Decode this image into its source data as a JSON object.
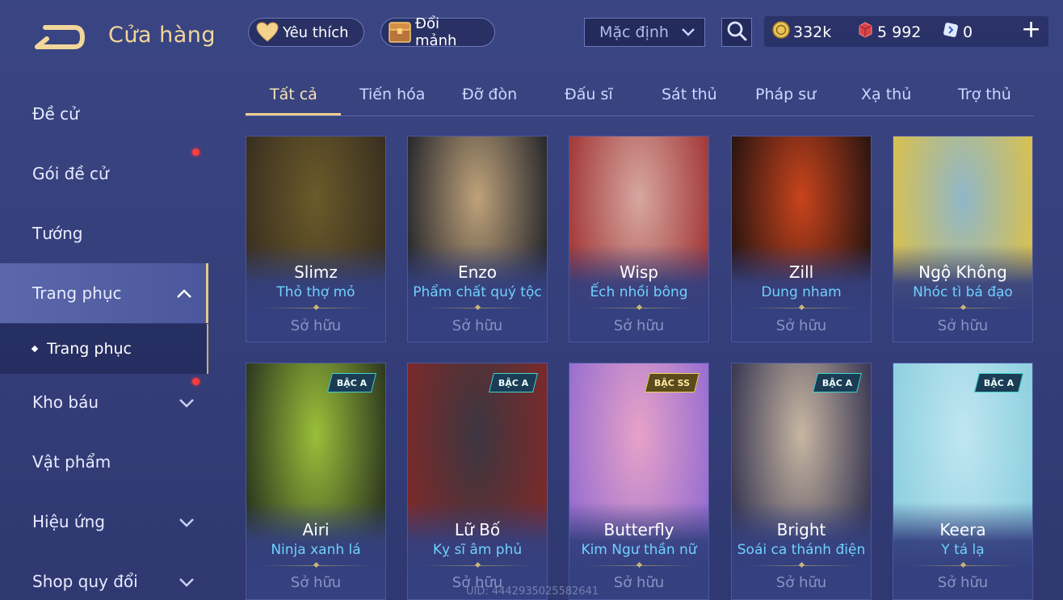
{
  "header": {
    "title": "Cửa hàng",
    "favorite_label": "Yêu thích",
    "shard_label": "Đổi mảnh",
    "sort_value": "Mặc định",
    "currencies": {
      "gold": "332k",
      "ruby": "5 992",
      "voucher": "0"
    },
    "plus_label": "+"
  },
  "sidebar": {
    "items": [
      {
        "label": "Đề cử"
      },
      {
        "label": "Gói đề cử"
      },
      {
        "label": "Tướng"
      },
      {
        "label": "Trang phục"
      },
      {
        "label": "Trang phục"
      },
      {
        "label": "Kho báu"
      },
      {
        "label": "Vật phẩm"
      },
      {
        "label": "Hiệu ứng"
      },
      {
        "label": "Shop quy đổi"
      }
    ]
  },
  "tabs": [
    "Tất cả",
    "Tiến hóa",
    "Đỡ đòn",
    "Đấu sĩ",
    "Sát thủ",
    "Pháp sư",
    "Xạ thủ",
    "Trợ thủ"
  ],
  "cards": [
    {
      "hero": "Slimz",
      "skin": "Thỏ thợ mỏ",
      "status": "Sở hữu",
      "badge": "",
      "colors": [
        "#6b5a2a",
        "#3a3020"
      ]
    },
    {
      "hero": "Enzo",
      "skin": "Phẩm chất quý tộc",
      "status": "Sở hữu",
      "badge": "",
      "colors": [
        "#bfa27a",
        "#2a2a2e"
      ]
    },
    {
      "hero": "Wisp",
      "skin": "Ếch nhồi bông",
      "status": "Sở hữu",
      "badge": "",
      "colors": [
        "#d7a7a0",
        "#a33a3a"
      ]
    },
    {
      "hero": "Zill",
      "skin": "Dung nham",
      "status": "Sở hữu",
      "badge": "",
      "colors": [
        "#c9441c",
        "#2b1511"
      ]
    },
    {
      "hero": "Ngộ Không",
      "skin": "Nhóc tì bá đạo",
      "status": "Sở hữu",
      "badge": "",
      "colors": [
        "#8fb7c9",
        "#d8c050"
      ]
    },
    {
      "hero": "Airi",
      "skin": "Ninja xanh lá",
      "status": "Sở hữu",
      "badge": "BẬC A",
      "colors": [
        "#9abf3a",
        "#2f3a1f"
      ]
    },
    {
      "hero": "Lữ Bố",
      "skin": "Kỵ sĩ âm phủ",
      "status": "Sở hữu",
      "badge": "BẬC A",
      "colors": [
        "#3c3640",
        "#7a2a2a"
      ]
    },
    {
      "hero": "Butterfly",
      "skin": "Kim Ngư thần nữ",
      "status": "Sở hữu",
      "badge": "BẬC SS",
      "colors": [
        "#e6a2c8",
        "#9a6fd0"
      ]
    },
    {
      "hero": "Bright",
      "skin": "Soái ca thánh điện",
      "status": "Sở hữu",
      "badge": "BẬC A",
      "colors": [
        "#c8b6a2",
        "#3b3a55"
      ]
    },
    {
      "hero": "Keera",
      "skin": "Y tá lạ",
      "status": "Sở hữu",
      "badge": "BẬC A",
      "colors": [
        "#bfe6f0",
        "#8fd0e0"
      ]
    }
  ],
  "uid_text": "UID: 4442935025582641"
}
